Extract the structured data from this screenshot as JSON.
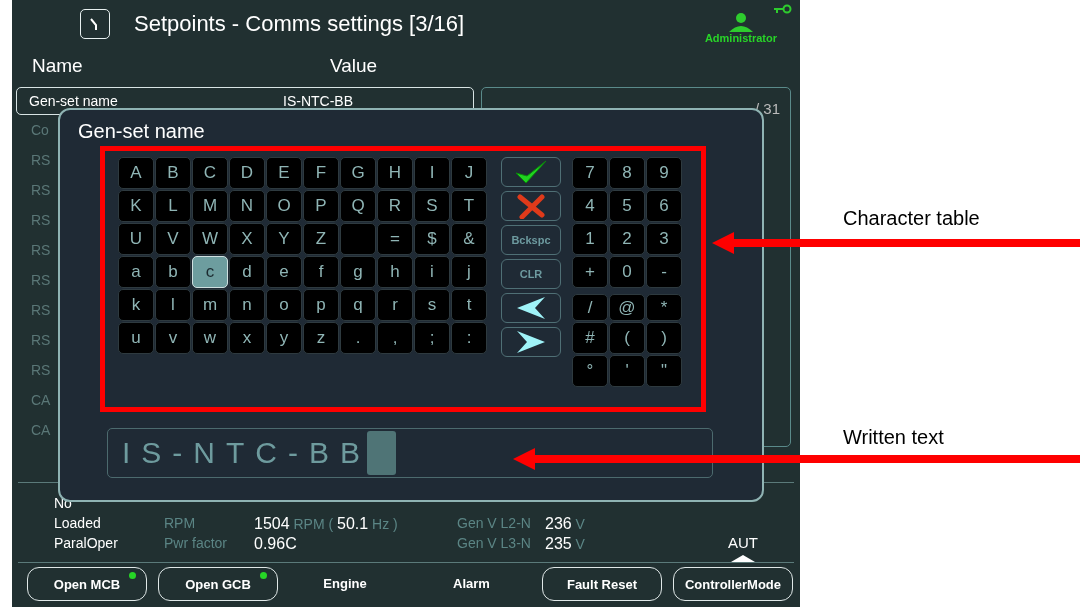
{
  "header": {
    "title": "Setpoints - Comms settings [3/16]",
    "user": "Administrator"
  },
  "columns": [
    "Name",
    "Value"
  ],
  "selected_row": {
    "name": "Gen-set name",
    "value": "IS-NTC-BB"
  },
  "rows": [
    "Co",
    "RS",
    "RS",
    "RS",
    "RS",
    "RS",
    "RS",
    "RS",
    "RS",
    "CA",
    "CA"
  ],
  "detail": {
    "counter": "/ 31"
  },
  "dialog": {
    "title": "Gen-set name",
    "letters": [
      [
        {
          "label": "A",
          "selected": false
        },
        {
          "label": "B",
          "selected": false
        },
        {
          "label": "C",
          "selected": false
        },
        {
          "label": "D",
          "selected": false
        },
        {
          "label": "E",
          "selected": false
        },
        {
          "label": "F",
          "selected": false
        },
        {
          "label": "G",
          "selected": false
        },
        {
          "label": "H",
          "selected": false
        },
        {
          "label": "I",
          "selected": false
        },
        {
          "label": "J",
          "selected": false
        }
      ],
      [
        {
          "label": "K",
          "selected": false
        },
        {
          "label": "L",
          "selected": false
        },
        {
          "label": "M",
          "selected": false
        },
        {
          "label": "N",
          "selected": false
        },
        {
          "label": "O",
          "selected": false
        },
        {
          "label": "P",
          "selected": false
        },
        {
          "label": "Q",
          "selected": false
        },
        {
          "label": "R",
          "selected": false
        },
        {
          "label": "S",
          "selected": false
        },
        {
          "label": "T",
          "selected": false
        }
      ],
      [
        {
          "label": "U",
          "selected": false
        },
        {
          "label": "V",
          "selected": false
        },
        {
          "label": "W",
          "selected": false
        },
        {
          "label": "X",
          "selected": false
        },
        {
          "label": "Y",
          "selected": false
        },
        {
          "label": "Z",
          "selected": false
        },
        {
          "selected": false
        },
        {
          "label": "=",
          "selected": false
        },
        {
          "label": "$",
          "selected": false
        },
        {
          "label": "&",
          "selected": false
        }
      ],
      [
        {
          "label": "a",
          "selected": false
        },
        {
          "label": "b",
          "selected": false
        },
        {
          "label": "c",
          "selected": true
        },
        {
          "label": "d",
          "selected": false
        },
        {
          "label": "e",
          "selected": false
        },
        {
          "label": "f",
          "selected": false
        },
        {
          "label": "g",
          "selected": false
        },
        {
          "label": "h",
          "selected": false
        },
        {
          "label": "i",
          "selected": false
        },
        {
          "label": "j",
          "selected": false
        }
      ],
      [
        {
          "label": "k",
          "selected": false
        },
        {
          "label": "l",
          "selected": false
        },
        {
          "label": "m",
          "selected": false
        },
        {
          "label": "n",
          "selected": false
        },
        {
          "label": "o",
          "selected": false
        },
        {
          "label": "p",
          "selected": false
        },
        {
          "label": "q",
          "selected": false
        },
        {
          "label": "r",
          "selected": false
        },
        {
          "label": "s",
          "selected": false
        },
        {
          "label": "t",
          "selected": false
        }
      ],
      [
        {
          "label": "u",
          "selected": false
        },
        {
          "label": "v",
          "selected": false
        },
        {
          "label": "w",
          "selected": false
        },
        {
          "label": "x",
          "selected": false
        },
        {
          "label": "y",
          "selected": false
        },
        {
          "label": "z",
          "selected": false
        },
        {
          "label": ".",
          "selected": false
        },
        {
          "label": ",",
          "selected": false
        },
        {
          "label": ";",
          "selected": false
        },
        {
          "label": ":",
          "selected": false
        }
      ]
    ],
    "actions": [
      {
        "kind": "confirm"
      },
      {
        "kind": "cancel"
      },
      {
        "kind": "text",
        "label": "Bckspc"
      },
      {
        "kind": "text",
        "label": "CLR"
      },
      {
        "kind": "left"
      },
      {
        "kind": "right"
      }
    ],
    "numpad": [
      [
        {
          "label": "7",
          "selected": false
        },
        {
          "label": "8",
          "selected": false
        },
        {
          "label": "9",
          "selected": false
        }
      ],
      [
        {
          "label": "4",
          "selected": false
        },
        {
          "label": "5",
          "selected": false
        },
        {
          "label": "6",
          "selected": false
        }
      ],
      [
        {
          "label": "1",
          "selected": false
        },
        {
          "label": "2",
          "selected": false
        },
        {
          "label": "3",
          "selected": false
        }
      ],
      [
        {
          "label": "+",
          "selected": false
        },
        {
          "label": "0",
          "selected": false
        },
        {
          "label": "-",
          "selected": false
        }
      ],
      [
        {
          "label": "/",
          "selected": false
        },
        {
          "label": "@",
          "selected": false
        },
        {
          "label": "*",
          "selected": false
        }
      ],
      [
        {
          "label": "#",
          "selected": false
        },
        {
          "label": "(",
          "selected": false
        },
        {
          "label": ")",
          "selected": false
        }
      ],
      [
        {
          "label": "°",
          "selected": false
        },
        {
          "label": "'",
          "selected": false
        },
        {
          "label": "\"",
          "selected": false
        }
      ]
    ],
    "value": "IS-NTC-BB"
  },
  "status_rows": [
    {
      "status": "No"
    },
    {
      "status": "Loaded",
      "label": "RPM",
      "value": "**1504** RPM ( **50.1** Hz )",
      "gen_label": "Gen V L2-N",
      "gen_value": "**236** V"
    },
    {
      "status": "ParalOper",
      "label": "Pwr factor",
      "value": "**0.96C**",
      "gen_label": "Gen V L3-N",
      "gen_value": "**235** V"
    }
  ],
  "mode": "AUT",
  "buttons": [
    {
      "kind": "button",
      "label": "Open MCB",
      "indicator": true
    },
    {
      "kind": "button",
      "label": "Open GCB",
      "indicator": true
    },
    {
      "kind": "label",
      "label": "Engine"
    },
    {
      "kind": "label",
      "label": "Alarm"
    },
    {
      "kind": "button",
      "label": "Fault Reset",
      "indicator": false
    },
    {
      "kind": "button",
      "label": "ControllerMode",
      "indicator": false
    }
  ],
  "annotations": [
    {
      "kind": "table",
      "label": "Character table"
    },
    {
      "kind": "field",
      "label": "Written text"
    }
  ]
}
